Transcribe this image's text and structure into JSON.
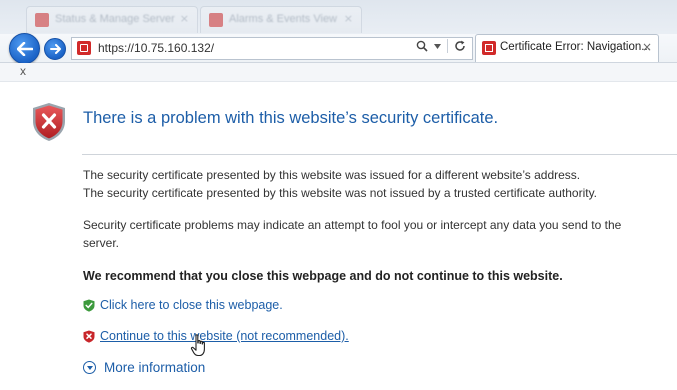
{
  "browser": {
    "background_tabs": [
      {
        "title": "Status & Manage Server"
      },
      {
        "title": "Alarms & Events View"
      }
    ],
    "address": {
      "url": "https://10.75.160.132/",
      "search_icon": "search-icon",
      "dropdown_icon": "chevron-down-icon",
      "refresh_icon": "refresh-icon"
    },
    "active_tab": {
      "title": "Certificate Error: Navigation...",
      "close": "×"
    },
    "subbar": {
      "close": "x"
    }
  },
  "page": {
    "title": "There is a problem with this website’s security certificate.",
    "paragraphs": [
      "The security certificate presented by this website was issued for a different website’s address.",
      "The security certificate presented by this website was not issued by a trusted certificate authority.",
      "Security certificate problems may indicate an attempt to fool you or intercept any data you send to the",
      "server."
    ],
    "recommendation": "We recommend that you close this webpage and do not continue to this website.",
    "close_link": "Click here to close this webpage.",
    "continue_link": "Continue to this website (not recommended).",
    "more_info": "More information"
  },
  "colors": {
    "title_blue": "#1d5ea8",
    "error_red": "#c8262a",
    "safe_green": "#3d9a3d"
  }
}
